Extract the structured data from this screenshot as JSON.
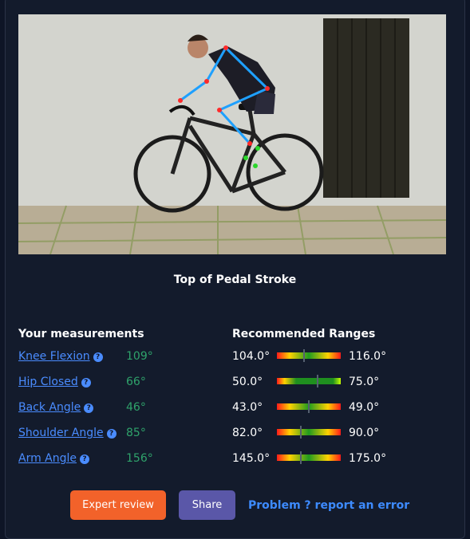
{
  "photo": {
    "alt": ""
  },
  "section_title": "Top of Pedal Stroke",
  "measurements_header": "Your measurements",
  "ranges_header": "Recommended Ranges",
  "help_glyph": "?",
  "rows": [
    {
      "label": "Knee Flexion",
      "value": "109°",
      "min": "104.0°",
      "max": "116.0°",
      "marker_fraction": 0.42,
      "style": "standard"
    },
    {
      "label": "Hip Closed",
      "value": "66°",
      "min": "50.0°",
      "max": "75.0°",
      "marker_fraction": 0.64,
      "style": "green"
    },
    {
      "label": "Back Angle",
      "value": "46°",
      "min": "43.0°",
      "max": "49.0°",
      "marker_fraction": 0.5,
      "style": "standard"
    },
    {
      "label": "Shoulder Angle",
      "value": "85°",
      "min": "82.0°",
      "max": "90.0°",
      "marker_fraction": 0.38,
      "style": "standard"
    },
    {
      "label": "Arm Angle",
      "value": "156°",
      "min": "145.0°",
      "max": "175.0°",
      "marker_fraction": 0.37,
      "style": "standard"
    }
  ],
  "buttons": {
    "expert_review": "Expert review",
    "share": "Share"
  },
  "report_link": "Problem ? report an error",
  "colors": {
    "accent_link": "#4a8cff",
    "value_green": "#2fa36b",
    "expert_button": "#f2622a",
    "share_button": "#5a57a8",
    "background": "#0e1526"
  }
}
